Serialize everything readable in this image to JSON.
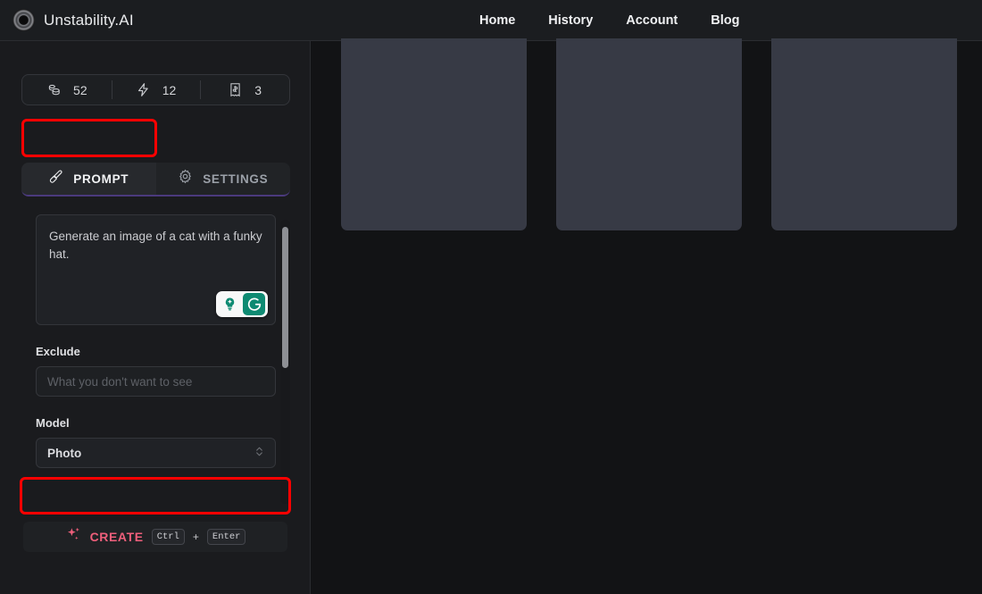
{
  "header": {
    "brand_name": "Unstability.AI",
    "logo_icon": "unstability-logo-icon",
    "nav": [
      {
        "label": "Home"
      },
      {
        "label": "History"
      },
      {
        "label": "Account"
      },
      {
        "label": "Blog"
      }
    ]
  },
  "sidebar": {
    "stats": [
      {
        "icon": "coins-icon",
        "value": "52"
      },
      {
        "icon": "lightning-bolt-icon",
        "value": "12"
      },
      {
        "icon": "receipt-icon",
        "value": "3"
      }
    ],
    "tabs": [
      {
        "label": "PROMPT",
        "icon": "paintbrush-icon",
        "active": true
      },
      {
        "label": "SETTINGS",
        "icon": "gear-icon",
        "active": false
      }
    ],
    "prompt": {
      "value": "Generate an image of a cat with a funky hat.",
      "grammarly_bulb_icon": "lightbulb-icon",
      "grammarly_logo_icon": "grammarly-g-icon"
    },
    "exclude": {
      "label": "Exclude",
      "placeholder": "What you don't want to see",
      "value": ""
    },
    "model": {
      "label": "Model",
      "value": "Photo",
      "options": [
        "Photo"
      ],
      "chevron_icon": "chevron-up-down-icon"
    },
    "create": {
      "label": "CREATE",
      "sparkles_icon": "sparkles-icon",
      "key_modifier": "Ctrl",
      "key_plus": "+",
      "key_action": "Enter"
    }
  },
  "main": {
    "results": [
      {
        "state": "placeholder"
      },
      {
        "state": "placeholder"
      },
      {
        "state": "placeholder"
      }
    ]
  },
  "colors": {
    "page_bg": "#121315",
    "panel_bg": "#1a1b1e",
    "header_bg": "#1b1d20",
    "accent_create": "#ef5f7b",
    "annotation": "#fe0000",
    "placeholder_card": "#373a45",
    "grammarly_teal": "#0e8a72"
  }
}
